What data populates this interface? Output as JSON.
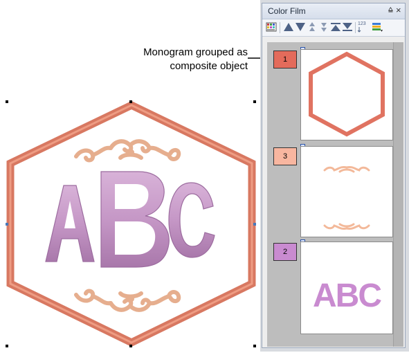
{
  "annotation": {
    "callout_line1": "Monogram grouped as",
    "callout_line2": "composite object"
  },
  "design": {
    "monogram_text": "ABC",
    "colors": {
      "hexagon": "#e07361",
      "ornament": "#f3b99a",
      "letters": "#c89ac8"
    }
  },
  "panel": {
    "title": "Color Film",
    "pin_glyph": "⩠",
    "close_glyph": "×",
    "toolbar_icons": [
      "color-grid-icon",
      "move-up-icon",
      "move-down-icon",
      "raise-icon",
      "lower-icon",
      "move-to-top-icon",
      "move-to-bottom-icon",
      "sequence-number-icon",
      "color-bars-icon"
    ],
    "toolbar_number_label": "123",
    "frames": [
      {
        "number": "1",
        "color": "#e36b5b",
        "content": "hexagon-outline"
      },
      {
        "number": "3",
        "color": "#f8b6a0",
        "content": "ornaments"
      },
      {
        "number": "2",
        "color": "#c98bd0",
        "content": "letters",
        "letters_text": "ABC"
      }
    ]
  }
}
